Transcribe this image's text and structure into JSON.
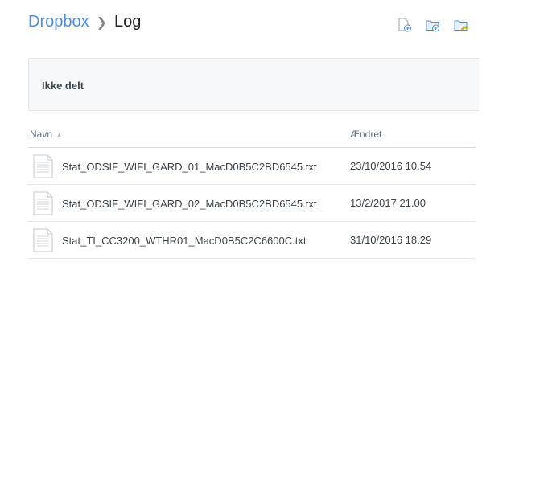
{
  "breadcrumb": {
    "root": "Dropbox",
    "current": "Log"
  },
  "toolbar": {
    "icons": [
      "new-file-icon",
      "new-folder-icon",
      "shared-folder-icon"
    ]
  },
  "banner": {
    "text": "Ikke delt"
  },
  "table": {
    "columns": {
      "name": "Navn",
      "modified": "Ændret"
    },
    "rows": [
      {
        "name": "Stat_ODSIF_WIFI_GARD_01_MacD0B5C2BD6545.txt",
        "modified": "23/10/2016 10.54"
      },
      {
        "name": "Stat_ODSIF_WIFI_GARD_02_MacD0B5C2BD6545.txt",
        "modified": "13/2/2017 21.00"
      },
      {
        "name": "Stat_TI_CC3200_WTHR01_MacD0B5C2C6600C.txt",
        "modified": "31/10/2016 18.29"
      }
    ]
  },
  "colors": {
    "accent": "#4a90e2"
  }
}
